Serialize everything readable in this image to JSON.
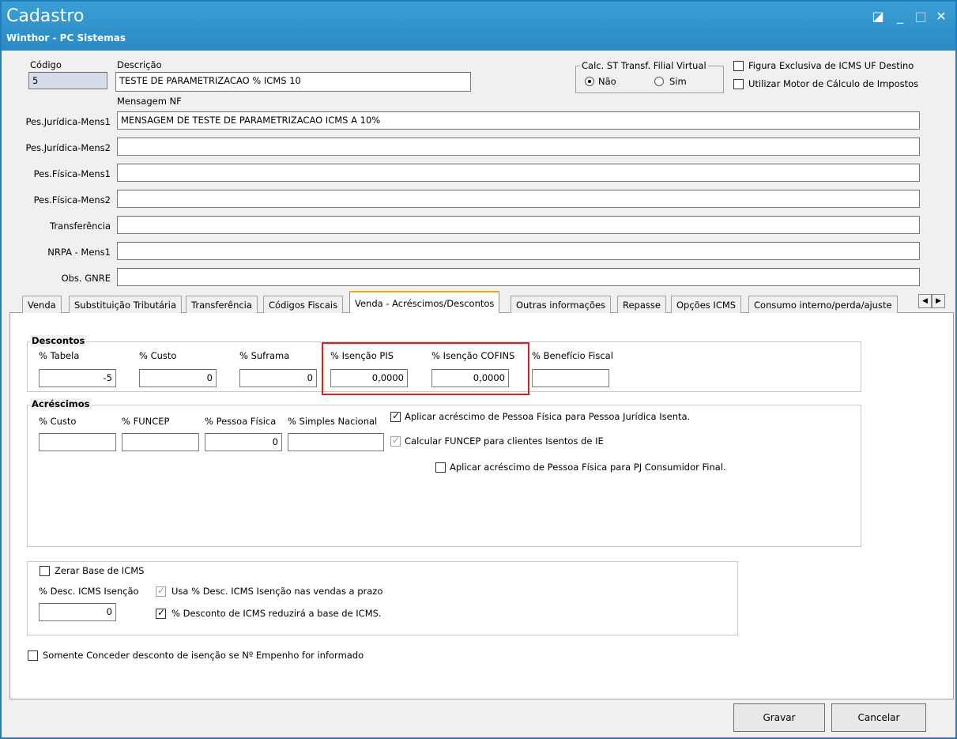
{
  "window": {
    "title": "Cadastro",
    "subtitle": "Winthor - PC Sistemas",
    "controls": {
      "restore": "◪",
      "minimize": "_",
      "maximize": "□",
      "close": "✕"
    }
  },
  "header": {
    "codigo_label": "Código",
    "codigo_value": "5",
    "descricao_label": "Descrição",
    "descricao_value": "TESTE DE PARAMETRIZACAO % ICMS 10",
    "calc_st_label": "Calc. ST Transf. Filial Virtual",
    "radio_nao": "Não",
    "radio_sim": "Sim",
    "figura_exclusiva": "Figura Exclusiva de ICMS UF Destino",
    "utilizar_motor": "Utilizar Motor de Cálculo de Impostos",
    "mensagem_nf_label": "Mensagem NF"
  },
  "messages": [
    {
      "label": "Pes.Jurídica-Mens1",
      "value": "MENSAGEM DE TESTE DE PARAMETRIZACAO ICMS A 10%"
    },
    {
      "label": "Pes.Jurídica-Mens2",
      "value": ""
    },
    {
      "label": "Pes.Física-Mens1",
      "value": ""
    },
    {
      "label": "Pes.Física-Mens2",
      "value": ""
    },
    {
      "label": "Transferência",
      "value": ""
    },
    {
      "label": "NRPA - Mens1",
      "value": ""
    },
    {
      "label": "Obs. GNRE",
      "value": ""
    }
  ],
  "tabs": [
    "Venda",
    "Substituição Tributária",
    "Transferência",
    "Códigos Fiscais",
    "Venda - Acréscimos/Descontos",
    "Outras informações",
    "Repasse",
    "Opções ICMS",
    "Consumo interno/perda/ajuste"
  ],
  "tab_scroll": {
    "left": "◀",
    "right": "▶"
  },
  "descontos": {
    "title": "Descontos",
    "tabela_label": "% Tabela",
    "tabela_value": "-5",
    "custo_label": "% Custo",
    "custo_value": "0",
    "suframa_label": "% Suframa",
    "suframa_value": "0",
    "isencao_pis_label": "% Isenção PIS",
    "isencao_pis_value": "0,0000",
    "isencao_cofins_label": "% Isenção COFINS",
    "isencao_cofins_value": "0,0000",
    "beneficio_label": "% Benefício Fiscal",
    "beneficio_value": ""
  },
  "acrescimos": {
    "title": "Acréscimos",
    "custo_label": "% Custo",
    "custo_value": "",
    "funcep_label": "% FUNCEP",
    "funcep_value": "",
    "pessoa_fisica_label": "% Pessoa Física",
    "pessoa_fisica_value": "0",
    "simples_label": "% Simples Nacional",
    "simples_value": "",
    "aplicar_pf_pj_isenta": "Aplicar acréscimo de Pessoa Física para Pessoa Jurídica Isenta.",
    "calcular_funcep": "Calcular FUNCEP para clientes Isentos de IE",
    "aplicar_pf_pj_consumidor": "Aplicar acréscimo de Pessoa Física para PJ Consumidor Final."
  },
  "icms": {
    "zerar_base": "Zerar Base de ICMS",
    "desc_icms_isencao_label": "% Desc. ICMS Isenção",
    "desc_icms_isencao_value": "0",
    "usa_desc_prazo": "Usa % Desc. ICMS Isenção nas vendas a prazo",
    "desconto_reduzira": "% Desconto de ICMS reduzirá a base de ICMS."
  },
  "somente_conceder": "Somente Conceder desconto de isenção se Nº Empenho for informado",
  "buttons": {
    "gravar": "Gravar",
    "cancelar": "Cancelar"
  }
}
